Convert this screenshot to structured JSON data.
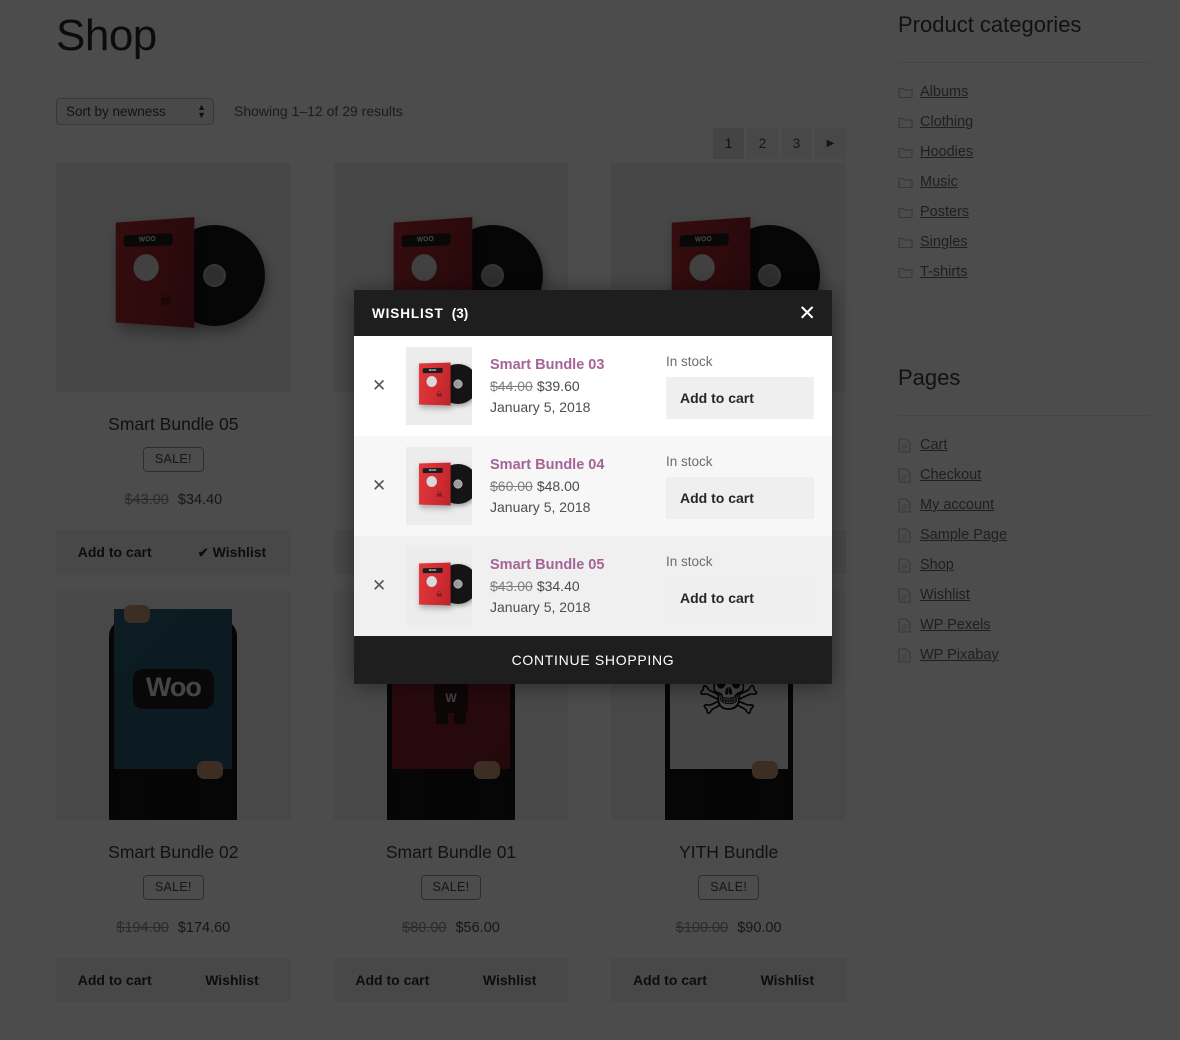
{
  "shop": {
    "page_title": "Shop",
    "sort_selected": "Sort by newness",
    "sort_options": [
      "Sort by newness"
    ],
    "result_count": "Showing 1–12 of 29 results",
    "pagination": [
      "1",
      "2",
      "3"
    ],
    "pagination_current": "1",
    "pagination_next_icon": "chevron-right-icon",
    "sale_label": "SALE!",
    "add_to_cart_label": "Add to cart",
    "wishlist_label": "Wishlist",
    "wishlist_checked_glyph": "✔"
  },
  "products": [
    {
      "name": "Smart Bundle 05",
      "on_sale": true,
      "regular_price": "$43.00",
      "sale_price": "$34.40",
      "in_wishlist": true,
      "art": "vinyl"
    },
    {
      "name": "Smart Bundle 04",
      "on_sale": true,
      "regular_price": "$60.00",
      "sale_price": "$48.00",
      "in_wishlist": false,
      "art": "vinyl"
    },
    {
      "name": "Smart Bundle 03",
      "on_sale": true,
      "regular_price": "$44.00",
      "sale_price": "$39.60",
      "in_wishlist": false,
      "art": "vinyl"
    },
    {
      "name": "Smart Bundle 02",
      "on_sale": true,
      "regular_price": "$194.00",
      "sale_price": "$174.60",
      "in_wishlist": false,
      "art": "poster-woo"
    },
    {
      "name": "Smart Bundle 01",
      "on_sale": true,
      "regular_price": "$80.00",
      "sale_price": "$56.00",
      "in_wishlist": false,
      "art": "poster-ninja"
    },
    {
      "name": "YITH Bundle",
      "on_sale": true,
      "regular_price": "$100.00",
      "sale_price": "$90.00",
      "in_wishlist": false,
      "art": "poster-skull"
    }
  ],
  "sidebar": {
    "product_categories": {
      "title": "Product categories",
      "icon": "folder-icon",
      "items": [
        "Albums",
        "Clothing",
        "Hoodies",
        "Music",
        "Posters",
        "Singles",
        "T-shirts"
      ]
    },
    "pages": {
      "title": "Pages",
      "icon": "page-icon",
      "items": [
        "Cart",
        "Checkout",
        "My account",
        "Sample Page",
        "Shop",
        "Wishlist",
        "WP Pexels",
        "WP Pixabay"
      ]
    }
  },
  "wishlist_modal": {
    "title": "WISHLIST",
    "count": "(3)",
    "close_icon": "close-icon",
    "remove_icon": "remove-item-icon",
    "continue_label": "CONTINUE SHOPPING",
    "add_to_cart_label": "Add to cart",
    "items": [
      {
        "name": "Smart Bundle 03",
        "regular_price": "$44.00",
        "sale_price": "$39.60",
        "date": "January 5, 2018",
        "stock": "In stock"
      },
      {
        "name": "Smart Bundle 04",
        "regular_price": "$60.00",
        "sale_price": "$48.00",
        "date": "January 5, 2018",
        "stock": "In stock"
      },
      {
        "name": "Smart Bundle 05",
        "regular_price": "$43.00",
        "sale_price": "$34.40",
        "date": "January 5, 2018",
        "stock": "In stock"
      }
    ]
  },
  "colors": {
    "modal_header_bg": "#1e1e1e",
    "product_link": "#a46497",
    "overlay": "rgba(0,0,0,0.70)",
    "button_bg": "#f1f1f1"
  }
}
